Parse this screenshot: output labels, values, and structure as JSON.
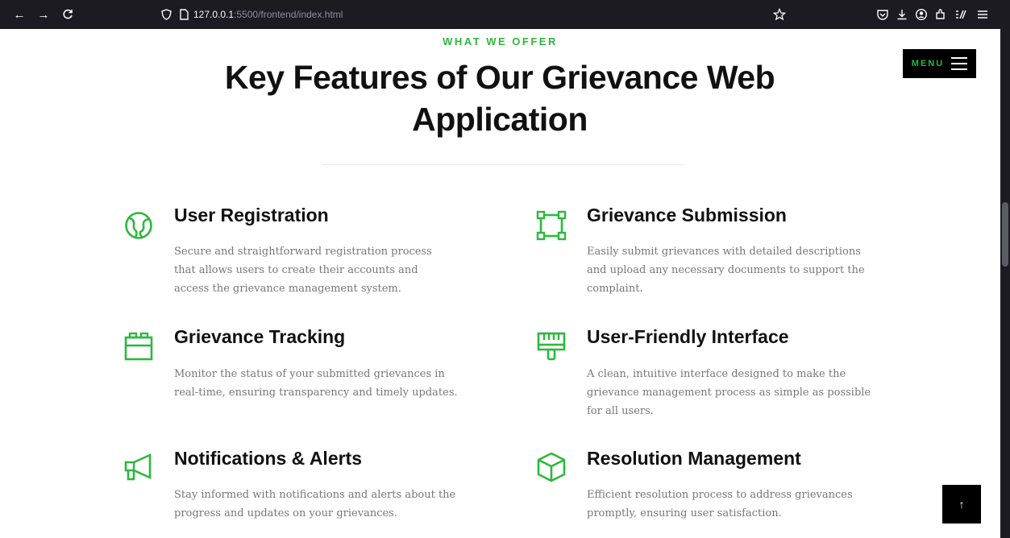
{
  "browser": {
    "url_host": "127.0.0.1",
    "url_path": ":5500/frontend/index.html"
  },
  "header": {
    "eyebrow": "WHAT WE OFFER",
    "title": "Key Features of Our Grievance Web Application"
  },
  "menu": {
    "label": "MENU"
  },
  "features": [
    {
      "title": "User Registration",
      "description": "Secure and straightforward registration process that allows users to create their accounts and access the grievance management system.",
      "icon": "globe-icon"
    },
    {
      "title": "Grievance Submission",
      "description": "Easily submit grievances with detailed descriptions and upload any necessary documents to support the complaint.",
      "icon": "vector-square-icon"
    },
    {
      "title": "Grievance Tracking",
      "description": "Monitor the status of your submitted grievances in real-time, ensuring transparency and timely updates.",
      "icon": "toolbox-icon"
    },
    {
      "title": "User-Friendly Interface",
      "description": "A clean, intuitive interface designed to make the grievance management process as simple as possible for all users.",
      "icon": "paint-brush-icon"
    },
    {
      "title": "Notifications & Alerts",
      "description": "Stay informed with notifications and alerts about the progress and updates on your grievances.",
      "icon": "megaphone-icon"
    },
    {
      "title": "Resolution Management",
      "description": "Efficient resolution process to address grievances promptly, ensuring user satisfaction.",
      "icon": "cube-icon"
    }
  ],
  "colors": {
    "accent": "#2db83d",
    "text": "#111111",
    "muted": "#777777"
  },
  "back_to_top": {
    "label": "↑"
  }
}
